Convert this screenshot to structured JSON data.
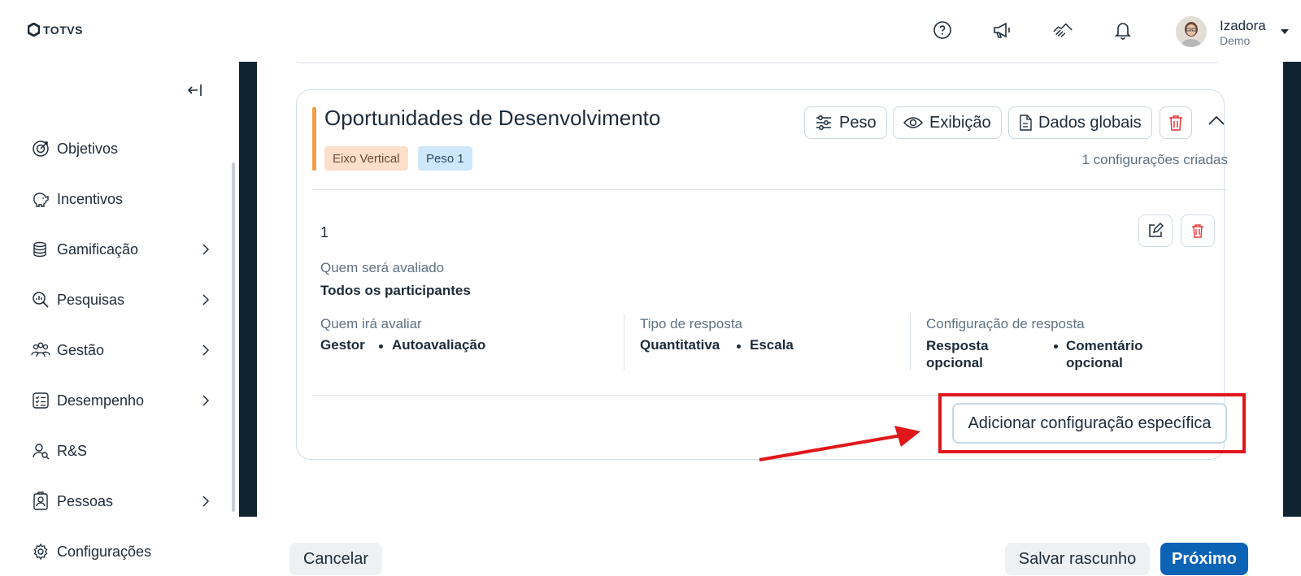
{
  "header": {
    "logo_text": "TOTVS",
    "user_name": "Izadora",
    "user_role": "Demo",
    "icons": [
      "help-icon",
      "megaphone-icon",
      "handshake-icon",
      "bell-icon"
    ]
  },
  "sidebar": {
    "items": [
      {
        "label": "Objetivos",
        "icon": "target-icon",
        "has_submenu": false
      },
      {
        "label": "Incentivos",
        "icon": "piggy-bank-icon",
        "has_submenu": false
      },
      {
        "label": "Gamificação",
        "icon": "coins-icon",
        "has_submenu": true
      },
      {
        "label": "Pesquisas",
        "icon": "search-chart-icon",
        "has_submenu": true
      },
      {
        "label": "Gestão",
        "icon": "people-icon",
        "has_submenu": true
      },
      {
        "label": "Desempenho",
        "icon": "checklist-icon",
        "has_submenu": true
      },
      {
        "label": "R&S",
        "icon": "person-search-icon",
        "has_submenu": false
      },
      {
        "label": "Pessoas",
        "icon": "badge-icon",
        "has_submenu": true
      },
      {
        "label": "Configurações",
        "icon": "gear-icon",
        "has_submenu": false
      }
    ]
  },
  "card": {
    "title": "Oportunidades de Desenvolvimento",
    "tags": [
      "Eixo Vertical",
      "Peso 1"
    ],
    "toolbar": {
      "weight_label": "Peso",
      "display_label": "Exibição",
      "global_data_label": "Dados globais"
    },
    "config_count_text": "1 configurações criadas",
    "rule": {
      "index": "1",
      "evaluated_label": "Quem será avaliado",
      "evaluated_value": "Todos os participantes",
      "evaluator_label": "Quem irá avaliar",
      "evaluator_values": [
        "Gestor",
        "Autoavaliação"
      ],
      "response_type_label": "Tipo de resposta",
      "response_type_values": [
        "Quantitativa",
        "Escala"
      ],
      "response_config_label": "Configuração de resposta",
      "response_config_values": [
        "Resposta opcional",
        "Comentário opcional"
      ]
    },
    "add_specific_label": "Adicionar configuração específica"
  },
  "footer": {
    "cancel_label": "Cancelar",
    "save_draft_label": "Salvar rascunho",
    "next_label": "Próximo"
  },
  "colors": {
    "primary": "#0b63b6",
    "accent_bar": "#f39c4a",
    "highlight": "#e0171b",
    "danger": "#e53935"
  }
}
